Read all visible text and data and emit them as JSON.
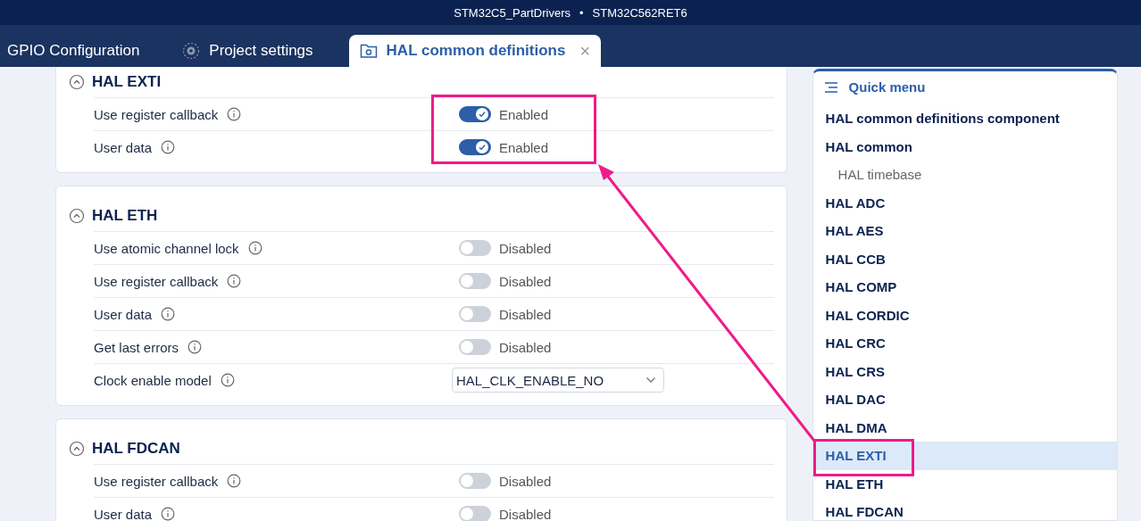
{
  "title_bar": {
    "project": "STM32C5_PartDrivers",
    "separator": "•",
    "device": "STM32C562RET6"
  },
  "tabs": [
    {
      "label": "GPIO Configuration",
      "selected": false
    },
    {
      "label": "Project settings",
      "selected": false
    },
    {
      "label": "HAL common definitions",
      "selected": true,
      "close_glyph": "×"
    }
  ],
  "sections": [
    {
      "title": "HAL EXTI",
      "expanded": true,
      "rows": [
        {
          "kind": "toggle",
          "label": "Use register callback",
          "on": true,
          "status": "Enabled"
        },
        {
          "kind": "toggle",
          "label": "User data",
          "on": true,
          "status": "Enabled"
        }
      ]
    },
    {
      "title": "HAL ETH",
      "expanded": true,
      "rows": [
        {
          "kind": "toggle",
          "label": "Use atomic channel lock",
          "on": false,
          "status": "Disabled"
        },
        {
          "kind": "toggle",
          "label": "Use register callback",
          "on": false,
          "status": "Disabled"
        },
        {
          "kind": "toggle",
          "label": "User data",
          "on": false,
          "status": "Disabled"
        },
        {
          "kind": "toggle",
          "label": "Get last errors",
          "on": false,
          "status": "Disabled"
        },
        {
          "kind": "select",
          "label": "Clock enable model",
          "value": "HAL_CLK_ENABLE_NO"
        }
      ]
    },
    {
      "title": "HAL FDCAN",
      "expanded": true,
      "rows": [
        {
          "kind": "toggle",
          "label": "Use register callback",
          "on": false,
          "status": "Disabled"
        },
        {
          "kind": "toggle",
          "label": "User data",
          "on": false,
          "status": "Disabled"
        }
      ]
    }
  ],
  "quick_menu": {
    "title": "Quick menu",
    "items": [
      {
        "label": "HAL common definitions component",
        "selected": false
      },
      {
        "label": "HAL common",
        "selected": false,
        "children": [
          {
            "label": "HAL timebase",
            "selected": false
          }
        ]
      },
      {
        "label": "HAL ADC",
        "selected": false
      },
      {
        "label": "HAL AES",
        "selected": false
      },
      {
        "label": "HAL CCB",
        "selected": false
      },
      {
        "label": "HAL COMP",
        "selected": false
      },
      {
        "label": "HAL CORDIC",
        "selected": false
      },
      {
        "label": "HAL CRC",
        "selected": false
      },
      {
        "label": "HAL CRS",
        "selected": false
      },
      {
        "label": "HAL DAC",
        "selected": false
      },
      {
        "label": "HAL DMA",
        "selected": false
      },
      {
        "label": "HAL EXTI",
        "selected": true
      },
      {
        "label": "HAL ETH",
        "selected": false
      },
      {
        "label": "HAL FDCAN",
        "selected": false
      }
    ]
  }
}
